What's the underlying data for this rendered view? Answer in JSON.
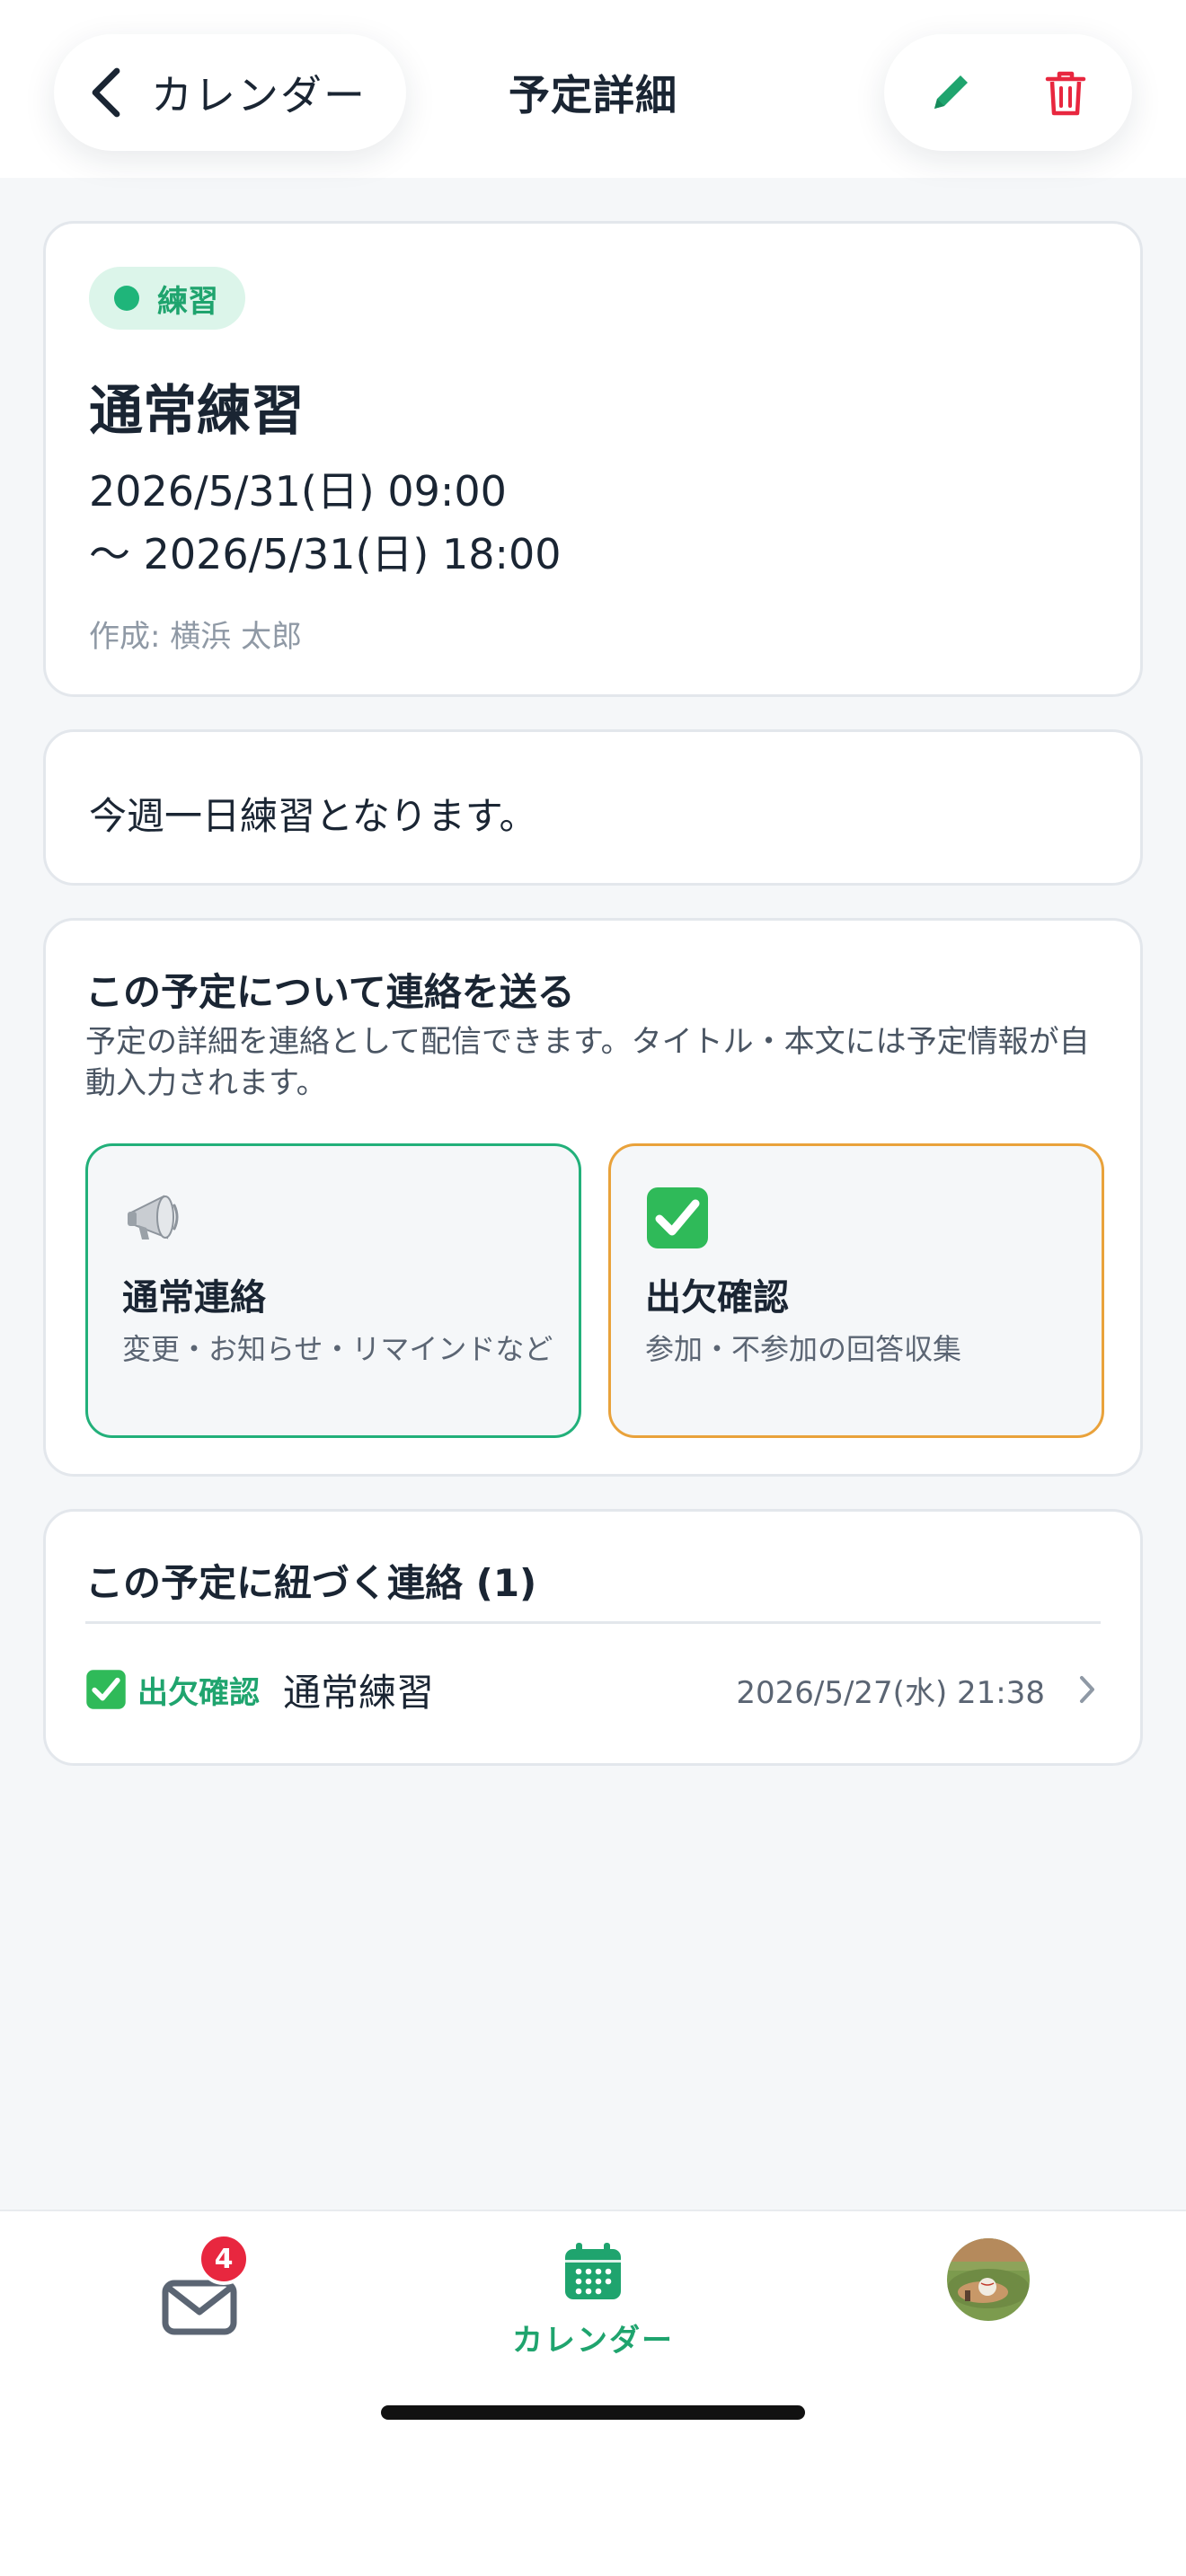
{
  "header": {
    "back_label": "カレンダー",
    "title": "予定詳細"
  },
  "event": {
    "category": "練習",
    "title": "通常練習",
    "start": "2026/5/31(日) 09:00",
    "end": "〜 2026/5/31(日) 18:00",
    "creator": "作成: 横浜 太郎",
    "description": "今週一日練習となります。"
  },
  "send": {
    "title": "この予定について連絡を送る",
    "description": "予定の詳細を連絡として配信できます。タイトル・本文には予定情報が自動入力されます。",
    "options": [
      {
        "title": "通常連絡",
        "subtitle": "変更・お知らせ・リマインドなど",
        "icon": "megaphone-icon"
      },
      {
        "title": "出欠確認",
        "subtitle": "参加・不参加の回答収集",
        "icon": "check-box-icon"
      }
    ]
  },
  "linked": {
    "title": "この予定に紐づく連絡 (1)",
    "items": [
      {
        "type": "出欠確認",
        "title": "通常練習",
        "date": "2026/5/27(水) 21:38"
      }
    ]
  },
  "tabbar": {
    "mail_badge": "4",
    "calendar_label": "カレンダー"
  },
  "colors": {
    "accent": "#1fa46e",
    "danger": "#e8273f",
    "attendance": "#e9a23b"
  }
}
